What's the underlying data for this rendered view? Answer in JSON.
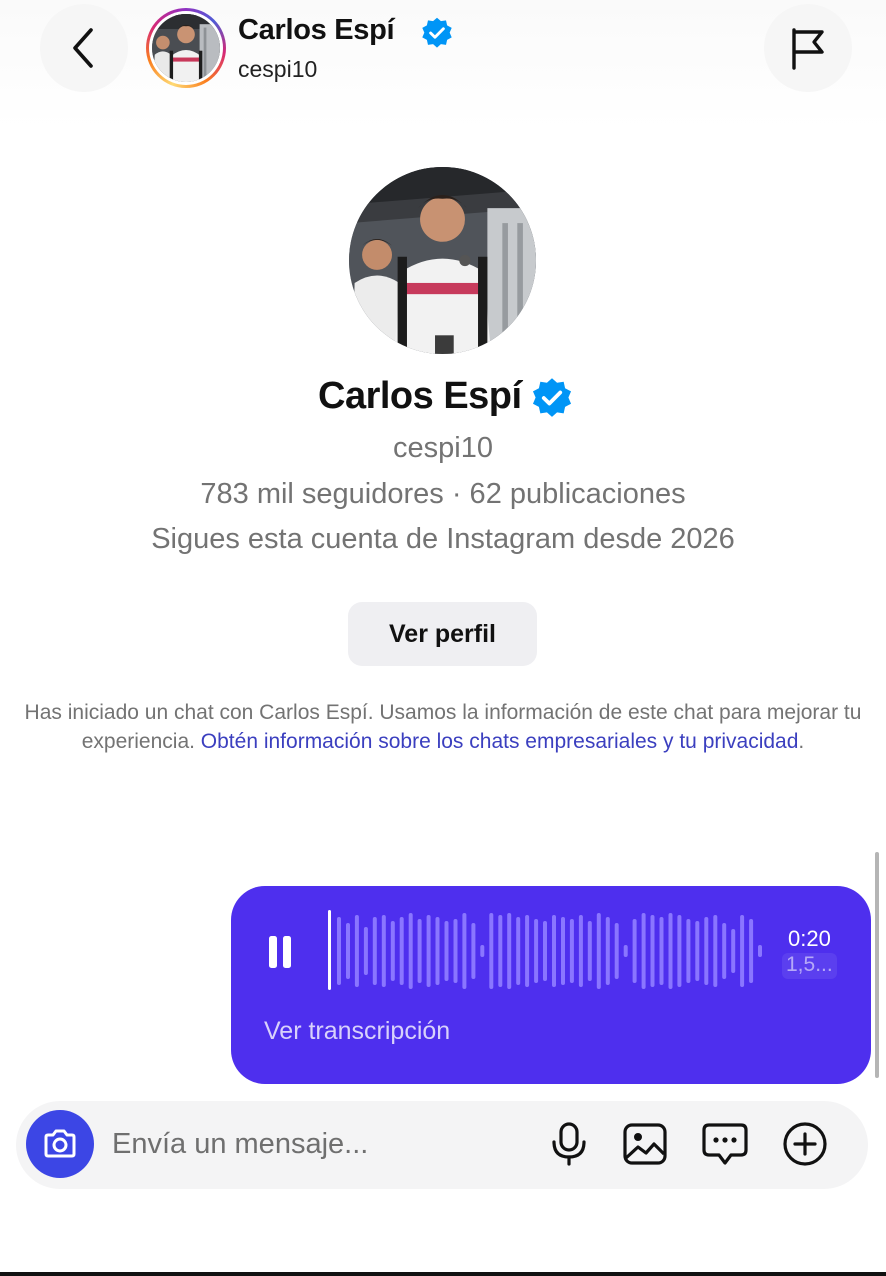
{
  "header": {
    "name": "Carlos Espí",
    "username": "cespi10"
  },
  "profile": {
    "name": "Carlos Espí",
    "username": "cespi10",
    "stats": "783 mil seguidores · 62 publicaciones",
    "since": "Sigues esta cuenta de Instagram desde 2026",
    "view_profile_label": "Ver perfil"
  },
  "notice": {
    "text": "Has iniciado un chat con Carlos Espí. Usamos la información de este chat para mejorar tu experiencia. ",
    "link": "Obtén información sobre los chats empresariales y tu privacidad",
    "end": "."
  },
  "voice_message": {
    "duration": "0:20",
    "speed": "1,5...",
    "transcript_label": "Ver transcripción",
    "bubble_color": "#4e2fee"
  },
  "composer": {
    "placeholder": "Envía un mensaje...",
    "camera_color": "#3c46e5"
  },
  "icons": [
    "back-arrow-icon",
    "flag-icon",
    "verified-badge-icon",
    "pause-icon",
    "camera-icon",
    "microphone-icon",
    "gallery-icon",
    "sticker-icon",
    "plus-icon"
  ]
}
